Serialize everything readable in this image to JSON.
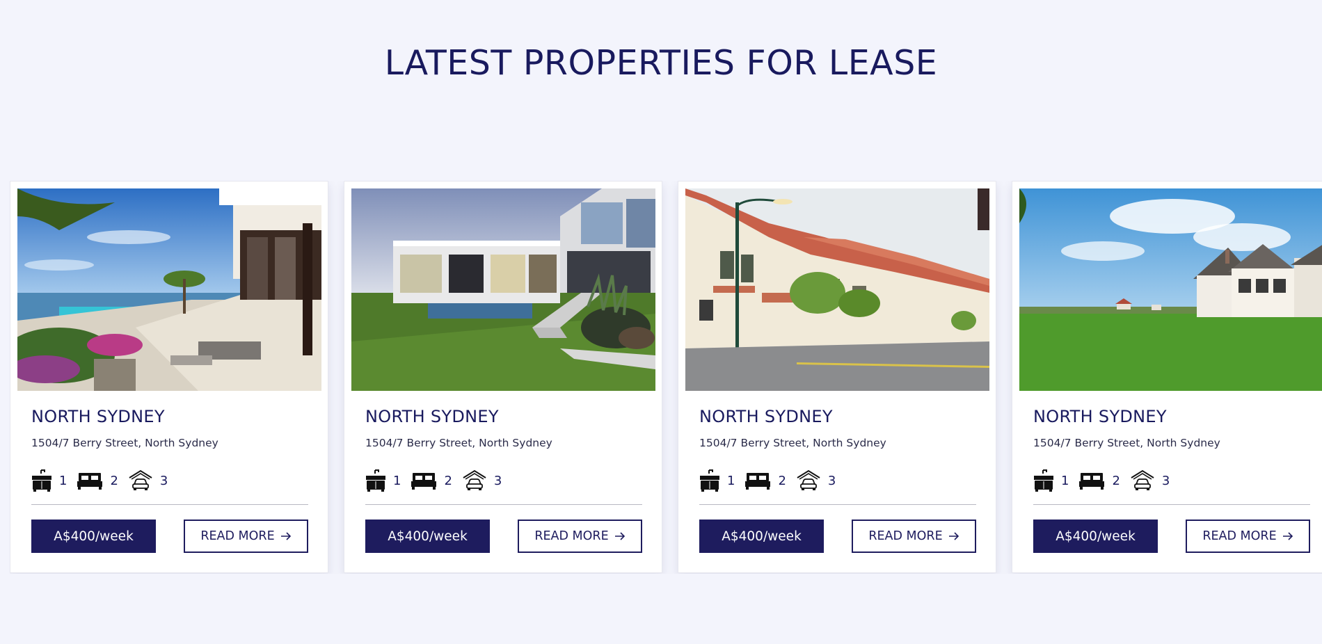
{
  "section": {
    "title": "LATEST PROPERTIES FOR LEASE"
  },
  "cards": [
    {
      "photo": "beach-resort-villa-photo",
      "title": "NORTH SYDNEY",
      "address": "1504/7 Berry Street, North Sydney",
      "features": {
        "bathrooms": "1",
        "bedrooms": "2",
        "garages": "3"
      },
      "price": "A$400/week",
      "read_more": "READ MORE"
    },
    {
      "photo": "modern-glass-house-photo",
      "title": "NORTH SYDNEY",
      "address": "1504/7 Berry Street, North Sydney",
      "features": {
        "bathrooms": "1",
        "bedrooms": "2",
        "garages": "3"
      },
      "price": "A$400/week",
      "read_more": "READ MORE"
    },
    {
      "photo": "townhouse-street-photo",
      "title": "NORTH SYDNEY",
      "address": "1504/7 Berry Street, North Sydney",
      "features": {
        "bathrooms": "1",
        "bedrooms": "2",
        "garages": "3"
      },
      "price": "A$400/week",
      "read_more": "READ MORE"
    },
    {
      "photo": "house-on-lawn-photo",
      "title": "NORTH SYDNEY",
      "address": "1504/7 Berry Street, North Sydney",
      "features": {
        "bathrooms": "1",
        "bedrooms": "2",
        "garages": "3"
      },
      "price": "A$400/week",
      "read_more": "READ MORE"
    }
  ],
  "icons": {
    "bathroom": "bathroom-vanity-icon",
    "bedroom": "bed-icon",
    "garage": "garage-car-icon",
    "arrow": "arrow-right-icon"
  },
  "colors": {
    "background": "#f3f4fc",
    "brand_navy": "#1e1c5e",
    "title_text": "#191a5e",
    "card_background": "#ffffff"
  }
}
